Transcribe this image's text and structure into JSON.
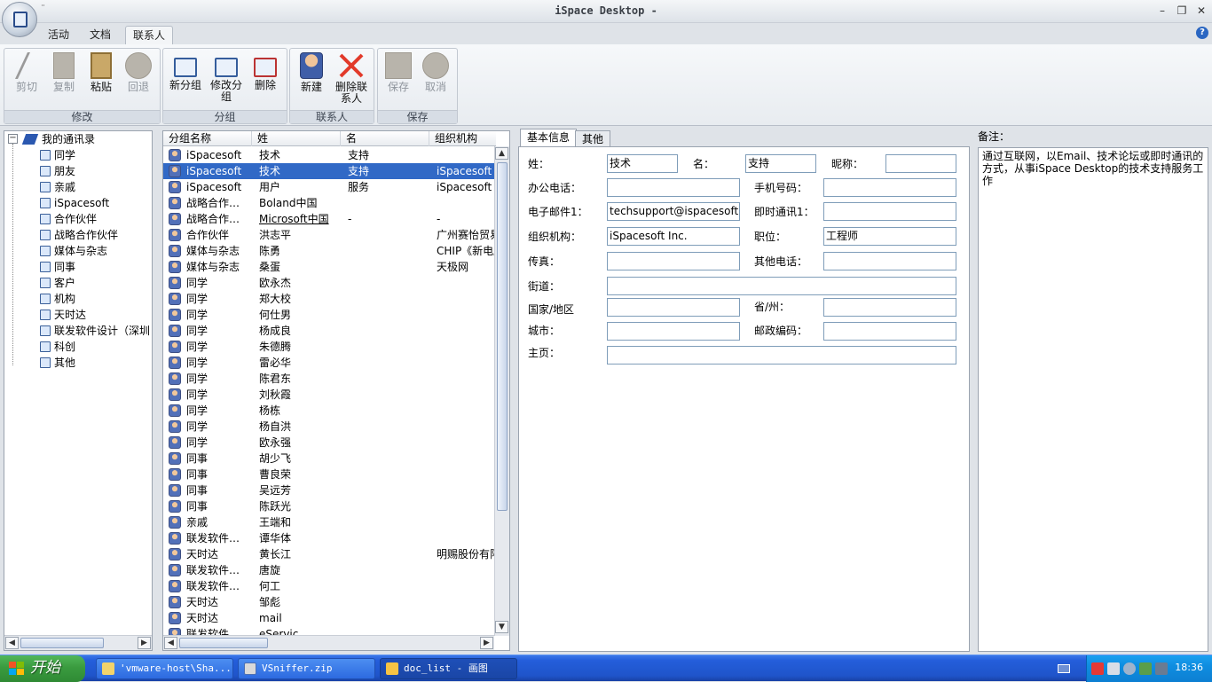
{
  "window": {
    "title": "iSpace Desktop -",
    "qat": "¨"
  },
  "tabs": [
    "活动",
    "文档",
    "联系人"
  ],
  "ribbon": {
    "groups": [
      {
        "label": "修改",
        "buttons": [
          "剪切",
          "复制",
          "粘贴",
          "回退"
        ]
      },
      {
        "label": "分组",
        "buttons": [
          "新分组",
          "修改分组",
          "删除"
        ]
      },
      {
        "label": "联系人",
        "buttons": [
          "新建",
          "删除联系人"
        ]
      },
      {
        "label": "保存",
        "buttons": [
          "保存",
          "取消"
        ]
      }
    ]
  },
  "tree": {
    "root": "我的通讯录",
    "items": [
      "同学",
      "朋友",
      "亲戚",
      "iSpacesoft",
      "合作伙伴",
      "战略合作伙伴",
      "媒体与杂志",
      "同事",
      "客户",
      "机构",
      "天时达",
      "联发软件设计（深圳",
      "科创",
      "其他"
    ]
  },
  "list": {
    "columns": [
      "分组名称",
      "姓",
      "名",
      "组织机构"
    ],
    "rows": [
      [
        "iSpacesoft",
        "技术",
        "支持",
        ""
      ],
      [
        "iSpacesoft",
        "技术",
        "支持",
        "iSpacesoft Inc"
      ],
      [
        "iSpacesoft",
        "用户",
        "服务",
        "iSpacesoft Inc"
      ],
      [
        "战略合作…",
        "Boland中国",
        "",
        ""
      ],
      [
        "战略合作…",
        "Microsoft中国",
        "-",
        "-"
      ],
      [
        "合作伙伴",
        "洪志平",
        "",
        "广州赛怡贸易"
      ],
      [
        "媒体与杂志",
        "陈勇",
        "",
        "CHIP《新电脑"
      ],
      [
        "媒体与杂志",
        "桑蛋",
        "",
        "天极网"
      ],
      [
        "同学",
        "欧永杰",
        "",
        ""
      ],
      [
        "同学",
        "郑大校",
        "",
        ""
      ],
      [
        "同学",
        "何仕男",
        "",
        ""
      ],
      [
        "同学",
        "杨成良",
        "",
        ""
      ],
      [
        "同学",
        "朱德腾",
        "",
        ""
      ],
      [
        "同学",
        "雷必华",
        "",
        ""
      ],
      [
        "同学",
        "陈君东",
        "",
        ""
      ],
      [
        "同学",
        "刘秋霞",
        "",
        ""
      ],
      [
        "同学",
        "杨栋",
        "",
        ""
      ],
      [
        "同学",
        "杨自洪",
        "",
        ""
      ],
      [
        "同学",
        "欧永强",
        "",
        ""
      ],
      [
        "同事",
        "胡少飞",
        "",
        ""
      ],
      [
        "同事",
        "曹良荣",
        "",
        ""
      ],
      [
        "同事",
        "吴远芳",
        "",
        ""
      ],
      [
        "同事",
        "陈跃光",
        "",
        ""
      ],
      [
        "亲戚",
        "王端和",
        "",
        ""
      ],
      [
        "联发软件…",
        "谭华体",
        "",
        ""
      ],
      [
        "天时达",
        "黄长江",
        "",
        "明赐股份有限"
      ],
      [
        "联发软件…",
        "唐旋",
        "",
        ""
      ],
      [
        "联发软件…",
        "何工",
        "",
        ""
      ],
      [
        "天时达",
        "邹彪",
        "",
        ""
      ],
      [
        "天时达",
        "mail",
        "",
        ""
      ],
      [
        "联发软件…",
        "eServic…",
        "",
        ""
      ]
    ]
  },
  "detail": {
    "tabs": [
      "基本信息",
      "其他"
    ],
    "labels": {
      "last": "姓：",
      "first": "名：",
      "nick": "昵称：",
      "office": "办公电话：",
      "mobile": "手机号码：",
      "email": "电子邮件1：",
      "im": "即时通讯1：",
      "org": "组织机构：",
      "title": "职位：",
      "fax": "传真：",
      "otherphone": "其他电话：",
      "street": "街道：",
      "country": "国家/地区",
      "province": "省/州：",
      "city": "城市：",
      "zip": "邮政编码：",
      "home": "主页："
    },
    "values": {
      "last": "技术",
      "first": "支持",
      "nick": "",
      "office": "",
      "mobile": "",
      "email": "techsupport@ispacesoft.com",
      "im": "",
      "org": "iSpacesoft Inc.",
      "title": "工程师",
      "fax": "",
      "otherphone": "",
      "street": "",
      "country": "",
      "province": "",
      "city": "",
      "zip": "",
      "home": ""
    }
  },
  "notes": {
    "label": "备注：",
    "text": "通过互联网，以Email、技术论坛或即时通讯的方式，从事iSpace Desktop的技术支持服务工作"
  },
  "taskbar": {
    "start": "开始",
    "tasks": [
      "'vmware-host\\Sha...",
      "VSniffer.zip",
      "doc_list - 画图"
    ],
    "clock": "18:36"
  }
}
